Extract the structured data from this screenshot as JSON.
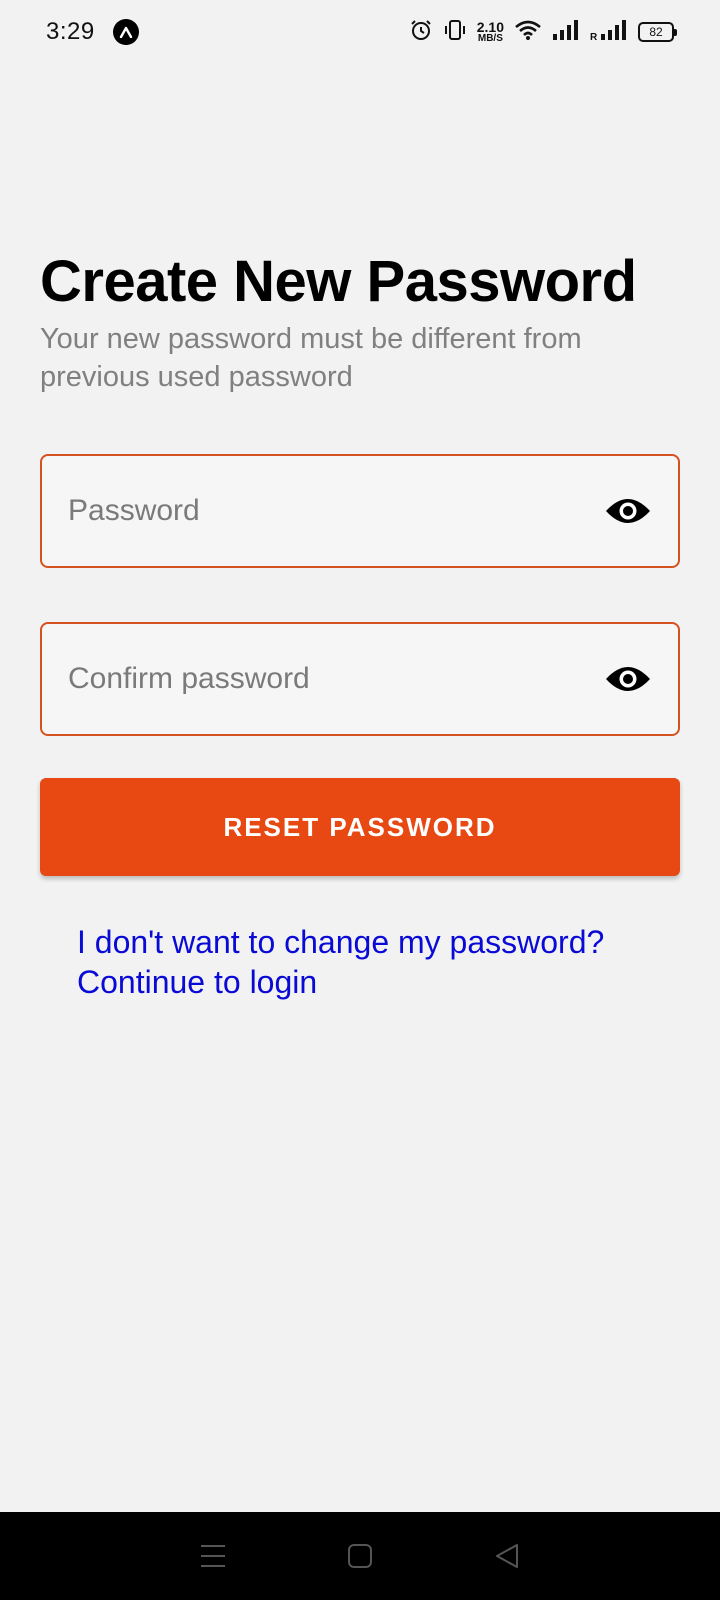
{
  "status_bar": {
    "time": "3:29",
    "speed_value": "2.10",
    "speed_unit": "MB/S",
    "battery": "82",
    "icons": [
      "app-notification-icon",
      "alarm-icon",
      "vibrate-icon",
      "wifi-icon",
      "signal-icon",
      "signal-roaming-icon",
      "battery-icon"
    ]
  },
  "page": {
    "title": "Create New Password",
    "subtitle": "Your new password must be different from previous used password"
  },
  "form": {
    "password_placeholder": "Password",
    "confirm_placeholder": "Confirm password",
    "reset_label": "RESET PASSWORD",
    "login_link": "I don't want to change my password? Continue to login"
  },
  "colors": {
    "accent": "#e84812",
    "field_border": "#d4521f",
    "link": "#0a0ad6",
    "background": "#f2f2f2"
  },
  "nav_bar": {
    "icons": [
      "menu-icon",
      "home-icon",
      "back-icon"
    ]
  }
}
